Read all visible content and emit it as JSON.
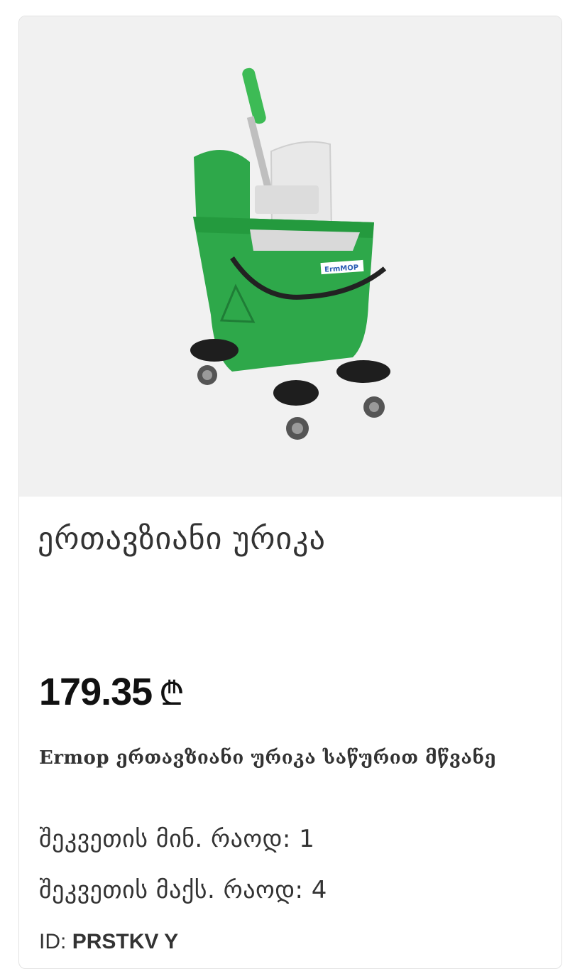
{
  "product": {
    "image_alt": "bucket-with-wringer",
    "title": "ერთავზიანი ურიკა",
    "price": "179.35",
    "currency": "₾",
    "description": "Ermop ერთავზიანი ურიკა საწურით მწვანე",
    "min_order_label": "შეკვეთის მინ. რაოდ:",
    "min_order_value": "1",
    "max_order_label": "შეკვეთის მაქს. რაოდ:",
    "max_order_value": "4",
    "id_label": "ID:",
    "id_value": "PRSTKV Y",
    "image_logo_text": "ErmMOP"
  },
  "colors": {
    "bucket": "#2ea84a",
    "handle": "#3dbb55",
    "wringer": "#e6e6e6",
    "background": "#f1f1f1"
  }
}
